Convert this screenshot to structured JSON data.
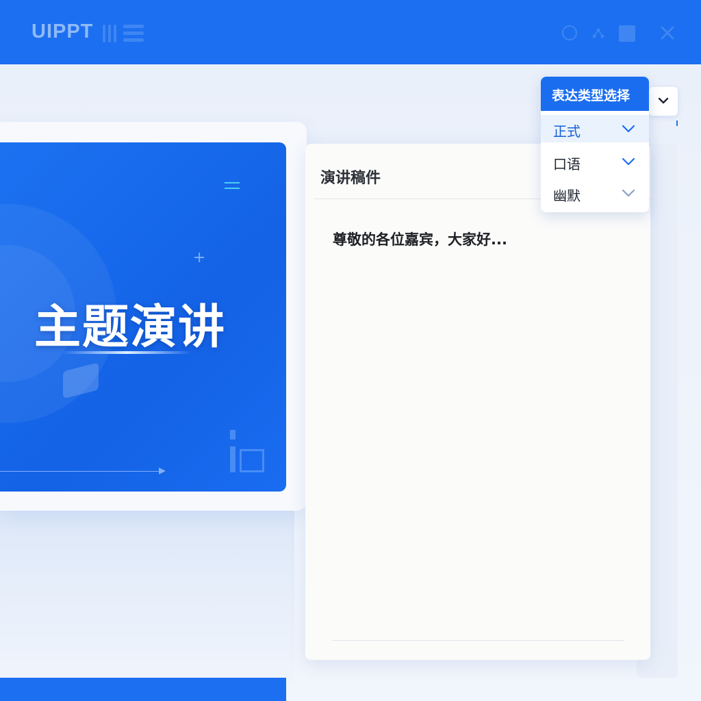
{
  "app": {
    "logo_text": "UIPPT"
  },
  "toolbar": {
    "icons": [
      "circle-icon",
      "share-icon",
      "square-icon",
      "close-icon"
    ]
  },
  "slide": {
    "title": "主题演讲"
  },
  "script_panel": {
    "title": "演讲稿件",
    "body": "尊敬的各位嘉宾，大家好..."
  },
  "expression_dropdown": {
    "header": "表达类型选择",
    "options": [
      {
        "label": "正式",
        "selected": true
      },
      {
        "label": "口语",
        "selected": false
      },
      {
        "label": "幽默",
        "selected": false
      }
    ]
  },
  "colors": {
    "brand": "#1c6ff0",
    "accent_cyan": "#49d0f4",
    "panel_bg": "#fbfbfa"
  }
}
